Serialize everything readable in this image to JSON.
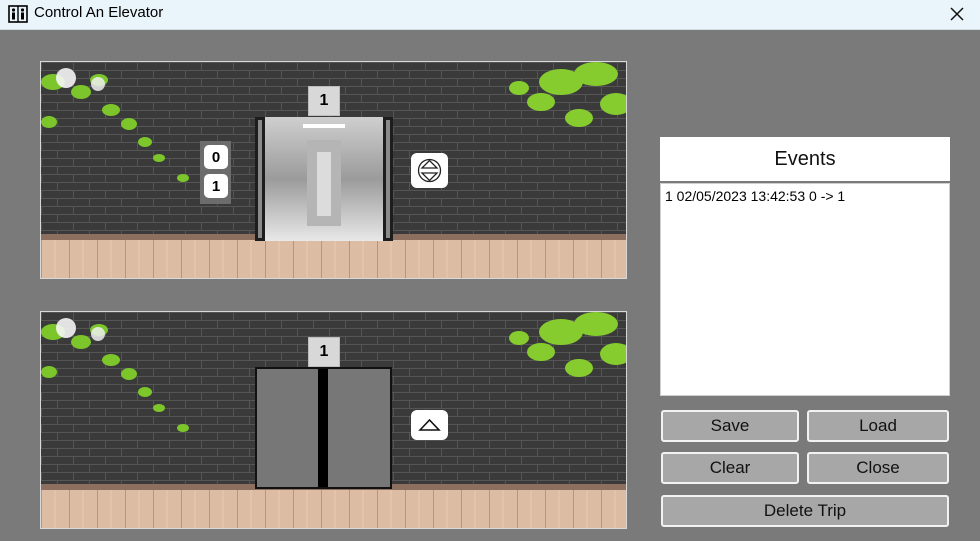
{
  "window": {
    "title": "Control An Elevator",
    "icon": "elevator-icon",
    "close_icon": "close-icon"
  },
  "scene_top": {
    "floor_indicator": "1",
    "call_buttons": [
      "0",
      "1"
    ],
    "direction_icon": "up-down-icon",
    "door_state": "open"
  },
  "scene_bottom": {
    "floor_indicator": "1",
    "direction_icon": "up-icon",
    "door_state": "closed"
  },
  "events": {
    "header": "Events",
    "items": [
      "1 02/05/2023 13:42:53 0 -> 1"
    ]
  },
  "buttons": {
    "save": "Save",
    "load": "Load",
    "clear": "Clear",
    "close": "Close",
    "delete_trip": "Delete Trip"
  },
  "colors": {
    "window_bg": "#7a7a7a",
    "titlebar_bg": "#eaf5fb",
    "button_bg": "#a7a7a7",
    "wall": "#3b3b3b",
    "floor": "#d9b9a0"
  }
}
